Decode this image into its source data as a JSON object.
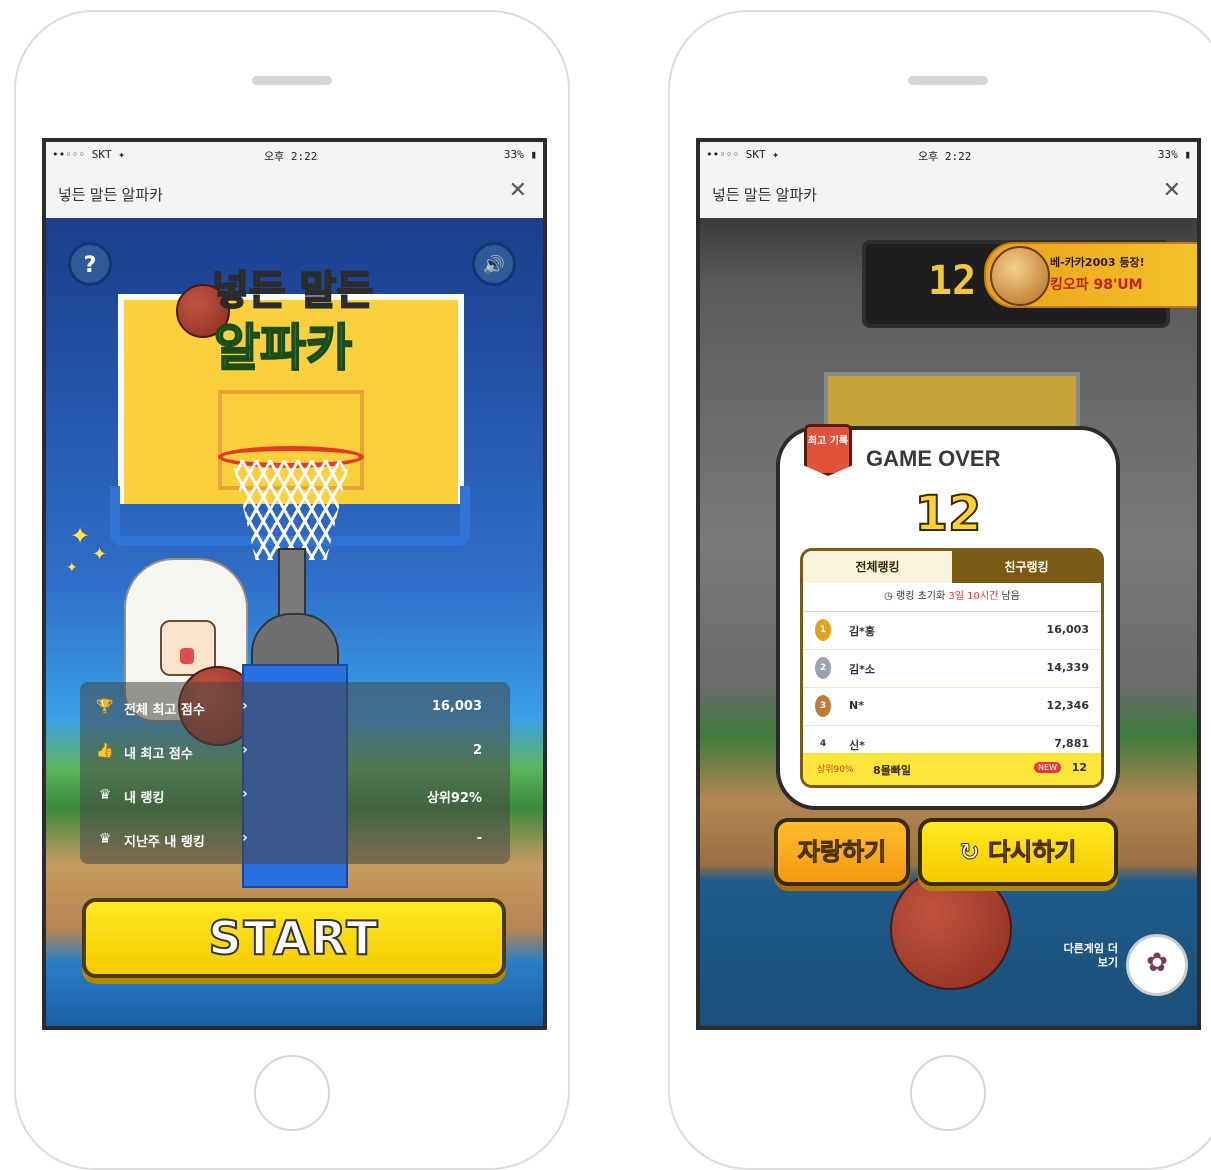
{
  "status_bar": {
    "carrier": "••◦◦◦ SKT ✦",
    "time": "오후 2:22",
    "battery": "33% ▮"
  },
  "window_title": "넣든 말든 알파카",
  "close_icon": "close-icon",
  "left_screen": {
    "help_label": "?",
    "sound_label": "🔊",
    "logo_line1": "넣든 말든",
    "logo_line2": "알파카",
    "stats": [
      {
        "icon": "trophy-icon",
        "label": "전체 최고 점수",
        "value": "16,003"
      },
      {
        "icon": "thumb-icon",
        "label": "내 최고 점수",
        "value": "2"
      },
      {
        "icon": "crown-icon",
        "label": "내 랭킹",
        "value": "상위92%"
      },
      {
        "icon": "crown-icon",
        "label": "지난주 내 랭킹",
        "value": "-"
      }
    ],
    "start_label": "START"
  },
  "right_screen": {
    "score_board": "12",
    "ad_line1": "베-카카2003 등장!",
    "ad_line2": "킹오파 98'UM",
    "badge": "최고\n기록",
    "game_over": "GAME OVER",
    "final_score": "12",
    "tab_all": "전체랭킹",
    "tab_friends": "친구랭킹",
    "notice_prefix": "랭킹 초기화",
    "notice_time": "3일 10시간",
    "notice_suffix": "남음",
    "rankings": [
      {
        "rank": "1",
        "name": "김*흥",
        "score": "16,003"
      },
      {
        "rank": "2",
        "name": "김*소",
        "score": "14,339"
      },
      {
        "rank": "3",
        "name": "N*",
        "score": "12,346"
      },
      {
        "rank": "4",
        "name": "신*",
        "score": "7,881"
      }
    ],
    "my_row": {
      "pct": "상위90%",
      "name": "8몰빠일",
      "new_badge": "NEW",
      "score": "12"
    },
    "share_label": "자랑하기",
    "retry_label": "다시하기",
    "more_games": "다른게임 더보기"
  }
}
